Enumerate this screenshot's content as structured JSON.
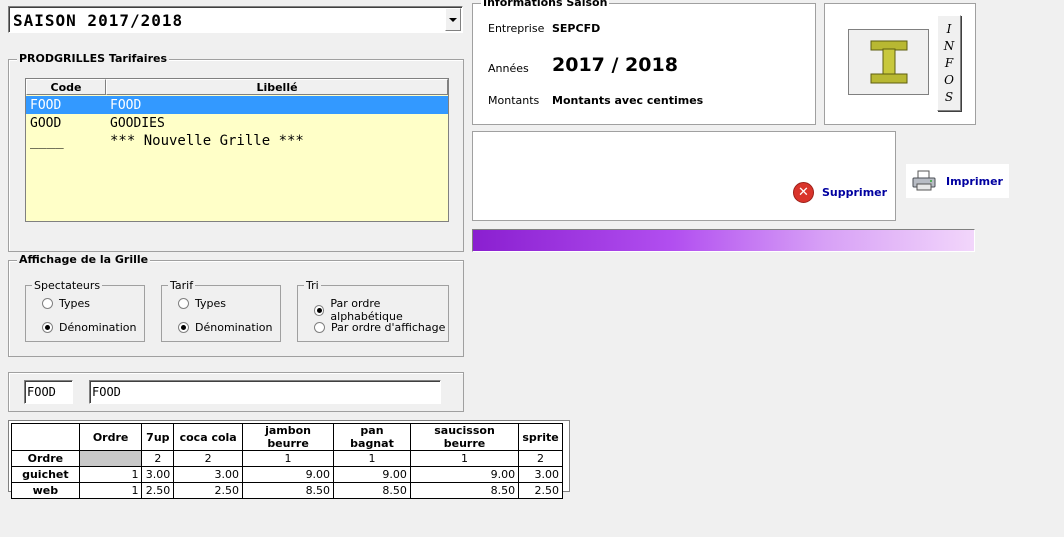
{
  "season_select": {
    "value": "SAISON 2017/2018"
  },
  "grilles": {
    "title": "PRODGRILLES Tarifaires",
    "col_code": "Code",
    "col_libelle": "Libellé",
    "rows": [
      {
        "code": "FOOD",
        "libelle": "FOOD"
      },
      {
        "code": "GOOD",
        "libelle": "GOODIES"
      },
      {
        "code": "____",
        "libelle": "*** Nouvelle Grille ***"
      }
    ]
  },
  "affichage": {
    "title": "Affichage de la Grille",
    "spectateurs": {
      "label": "Spectateurs",
      "opt1": "Types",
      "opt2": "Dénomination"
    },
    "tarif": {
      "label": "Tarif",
      "opt1": "Types",
      "opt2": "Dénomination"
    },
    "tri": {
      "label": "Tri",
      "opt1": "Par ordre alphabétique",
      "opt2": "Par ordre d'affichage"
    }
  },
  "code_field": {
    "code": "FOOD",
    "libelle": "FOOD"
  },
  "info_saison": {
    "title": "Informations Saison",
    "entreprise_label": "Entreprise",
    "entreprise_value": "SEPCFD",
    "annees_label": "Années",
    "annees_value": "2017 / 2018",
    "montants_label": "Montants",
    "montants_value": "Montants avec centimes"
  },
  "infos_button": {
    "letters": [
      "I",
      "N",
      "F",
      "O",
      "S"
    ]
  },
  "actions": {
    "supprimer": "Supprimer",
    "imprimer": "Imprimer"
  },
  "table": {
    "corner": "",
    "ordre_col_header": "Ordre",
    "columns": [
      "7up",
      "coca cola",
      "jambon beurre",
      "pan bagnat",
      "saucisson beurre",
      "sprite"
    ],
    "ordre_row": {
      "label": "Ordre",
      "values": [
        "2",
        "2",
        "1",
        "1",
        "1",
        "2"
      ]
    },
    "rows": [
      {
        "label": "guichet",
        "ordre": "1",
        "values": [
          "3.00",
          "3.00",
          "9.00",
          "9.00",
          "9.00",
          "3.00"
        ]
      },
      {
        "label": "web",
        "ordre": "1",
        "values": [
          "2.50",
          "2.50",
          "8.50",
          "8.50",
          "8.50",
          "2.50"
        ]
      }
    ]
  },
  "colors": {
    "selection": "#3399ff",
    "list_bg": "#ffffc8",
    "progress_start": "#8a1fd0",
    "progress_end": "#f2d6fb"
  }
}
